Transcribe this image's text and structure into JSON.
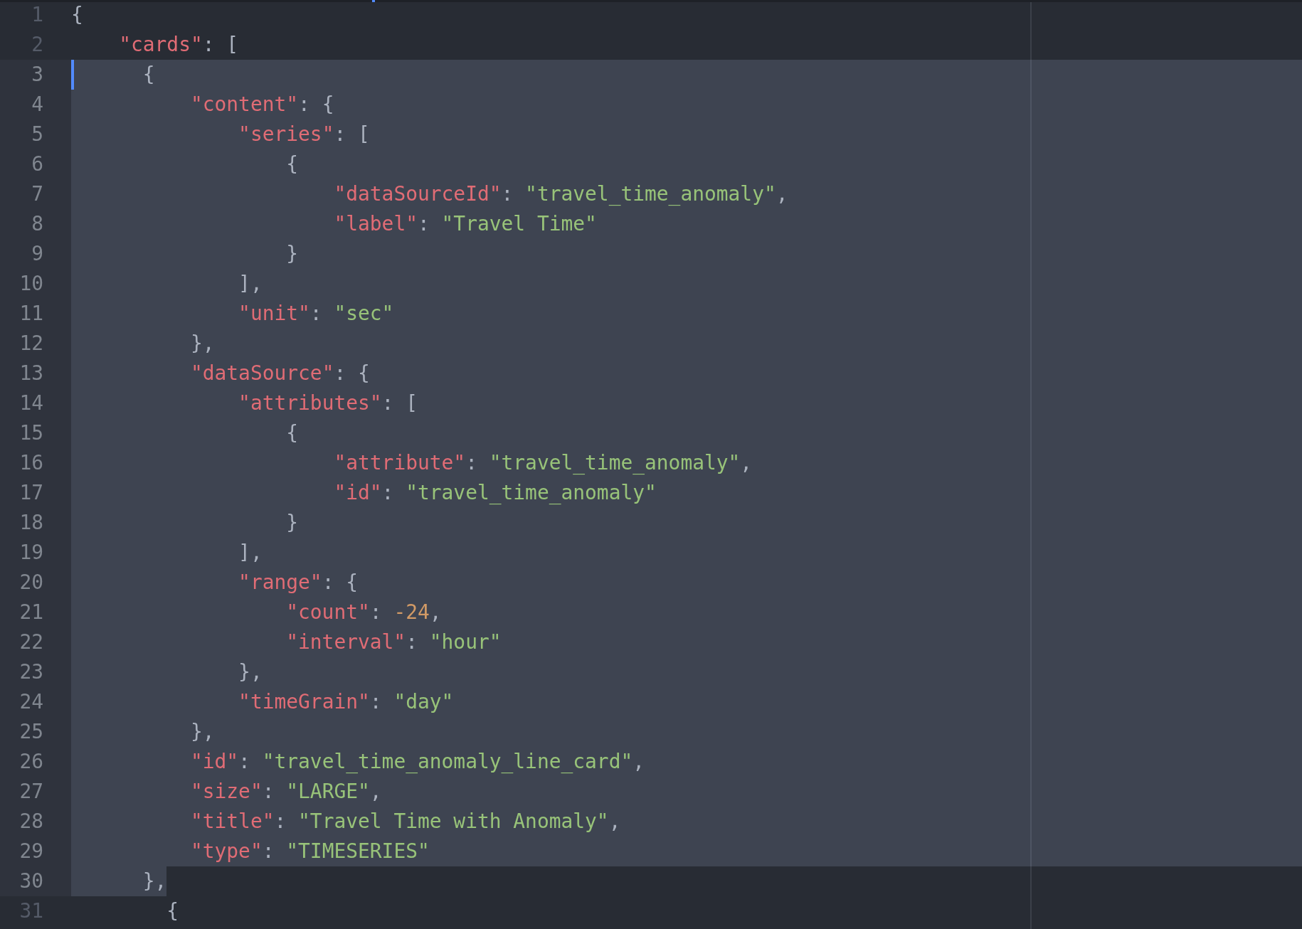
{
  "editor": {
    "lines": [
      {
        "number": "1",
        "selected": false,
        "cursor": false,
        "tokens": [
          {
            "kind": "punct",
            "text": "{"
          }
        ]
      },
      {
        "number": "2",
        "selected": false,
        "cursor": false,
        "tokens": [
          {
            "kind": "key",
            "text": "    \"cards\""
          },
          {
            "kind": "punct",
            "text": ": ["
          }
        ]
      },
      {
        "number": "3",
        "selected": true,
        "whole_line": true,
        "cursor": true,
        "tokens": [
          {
            "kind": "punct",
            "text": "      {"
          }
        ]
      },
      {
        "number": "4",
        "selected": true,
        "whole_line": true,
        "cursor": false,
        "tokens": [
          {
            "kind": "key",
            "text": "          \"content\""
          },
          {
            "kind": "punct",
            "text": ": {"
          }
        ]
      },
      {
        "number": "5",
        "selected": true,
        "whole_line": true,
        "cursor": false,
        "tokens": [
          {
            "kind": "key",
            "text": "              \"series\""
          },
          {
            "kind": "punct",
            "text": ": ["
          }
        ]
      },
      {
        "number": "6",
        "selected": true,
        "whole_line": true,
        "cursor": false,
        "tokens": [
          {
            "kind": "punct",
            "text": "                  {"
          }
        ]
      },
      {
        "number": "7",
        "selected": true,
        "whole_line": true,
        "cursor": false,
        "tokens": [
          {
            "kind": "key",
            "text": "                      \"dataSourceId\""
          },
          {
            "kind": "punct",
            "text": ": "
          },
          {
            "kind": "string",
            "text": "\"travel_time_anomaly\""
          },
          {
            "kind": "punct",
            "text": ","
          }
        ]
      },
      {
        "number": "8",
        "selected": true,
        "whole_line": true,
        "cursor": false,
        "tokens": [
          {
            "kind": "key",
            "text": "                      \"label\""
          },
          {
            "kind": "punct",
            "text": ": "
          },
          {
            "kind": "string",
            "text": "\"Travel Time\""
          }
        ]
      },
      {
        "number": "9",
        "selected": true,
        "whole_line": true,
        "cursor": false,
        "tokens": [
          {
            "kind": "punct",
            "text": "                  }"
          }
        ]
      },
      {
        "number": "10",
        "selected": true,
        "whole_line": true,
        "cursor": false,
        "tokens": [
          {
            "kind": "punct",
            "text": "              ],"
          }
        ]
      },
      {
        "number": "11",
        "selected": true,
        "whole_line": true,
        "cursor": false,
        "tokens": [
          {
            "kind": "key",
            "text": "              \"unit\""
          },
          {
            "kind": "punct",
            "text": ": "
          },
          {
            "kind": "string",
            "text": "\"sec\""
          }
        ]
      },
      {
        "number": "12",
        "selected": true,
        "whole_line": true,
        "cursor": false,
        "tokens": [
          {
            "kind": "punct",
            "text": "          },"
          }
        ]
      },
      {
        "number": "13",
        "selected": true,
        "whole_line": true,
        "cursor": false,
        "tokens": [
          {
            "kind": "key",
            "text": "          \"dataSource\""
          },
          {
            "kind": "punct",
            "text": ": {"
          }
        ]
      },
      {
        "number": "14",
        "selected": true,
        "whole_line": true,
        "cursor": false,
        "tokens": [
          {
            "kind": "key",
            "text": "              \"attributes\""
          },
          {
            "kind": "punct",
            "text": ": ["
          }
        ]
      },
      {
        "number": "15",
        "selected": true,
        "whole_line": true,
        "cursor": false,
        "tokens": [
          {
            "kind": "punct",
            "text": "                  {"
          }
        ]
      },
      {
        "number": "16",
        "selected": true,
        "whole_line": true,
        "cursor": false,
        "tokens": [
          {
            "kind": "key",
            "text": "                      \"attribute\""
          },
          {
            "kind": "punct",
            "text": ": "
          },
          {
            "kind": "string",
            "text": "\"travel_time_anomaly\""
          },
          {
            "kind": "punct",
            "text": ","
          }
        ]
      },
      {
        "number": "17",
        "selected": true,
        "whole_line": true,
        "cursor": false,
        "tokens": [
          {
            "kind": "key",
            "text": "                      \"id\""
          },
          {
            "kind": "punct",
            "text": ": "
          },
          {
            "kind": "string",
            "text": "\"travel_time_anomaly\""
          }
        ]
      },
      {
        "number": "18",
        "selected": true,
        "whole_line": true,
        "cursor": false,
        "tokens": [
          {
            "kind": "punct",
            "text": "                  }"
          }
        ]
      },
      {
        "number": "19",
        "selected": true,
        "whole_line": true,
        "cursor": false,
        "tokens": [
          {
            "kind": "punct",
            "text": "              ],"
          }
        ]
      },
      {
        "number": "20",
        "selected": true,
        "whole_line": true,
        "cursor": false,
        "tokens": [
          {
            "kind": "key",
            "text": "              \"range\""
          },
          {
            "kind": "punct",
            "text": ": {"
          }
        ]
      },
      {
        "number": "21",
        "selected": true,
        "whole_line": true,
        "cursor": false,
        "tokens": [
          {
            "kind": "key",
            "text": "                  \"count\""
          },
          {
            "kind": "punct",
            "text": ": "
          },
          {
            "kind": "number",
            "text": "-24"
          },
          {
            "kind": "punct",
            "text": ","
          }
        ]
      },
      {
        "number": "22",
        "selected": true,
        "whole_line": true,
        "cursor": false,
        "tokens": [
          {
            "kind": "key",
            "text": "                  \"interval\""
          },
          {
            "kind": "punct",
            "text": ": "
          },
          {
            "kind": "string",
            "text": "\"hour\""
          }
        ]
      },
      {
        "number": "23",
        "selected": true,
        "whole_line": true,
        "cursor": false,
        "tokens": [
          {
            "kind": "punct",
            "text": "              },"
          }
        ]
      },
      {
        "number": "24",
        "selected": true,
        "whole_line": true,
        "cursor": false,
        "tokens": [
          {
            "kind": "key",
            "text": "              \"timeGrain\""
          },
          {
            "kind": "punct",
            "text": ": "
          },
          {
            "kind": "string",
            "text": "\"day\""
          }
        ]
      },
      {
        "number": "25",
        "selected": true,
        "whole_line": true,
        "cursor": false,
        "tokens": [
          {
            "kind": "punct",
            "text": "          },"
          }
        ]
      },
      {
        "number": "26",
        "selected": true,
        "whole_line": true,
        "cursor": false,
        "tokens": [
          {
            "kind": "key",
            "text": "          \"id\""
          },
          {
            "kind": "punct",
            "text": ": "
          },
          {
            "kind": "string",
            "text": "\"travel_time_anomaly_line_card\""
          },
          {
            "kind": "punct",
            "text": ","
          }
        ]
      },
      {
        "number": "27",
        "selected": true,
        "whole_line": true,
        "cursor": false,
        "tokens": [
          {
            "kind": "key",
            "text": "          \"size\""
          },
          {
            "kind": "punct",
            "text": ": "
          },
          {
            "kind": "string",
            "text": "\"LARGE\""
          },
          {
            "kind": "punct",
            "text": ","
          }
        ]
      },
      {
        "number": "28",
        "selected": true,
        "whole_line": true,
        "cursor": false,
        "tokens": [
          {
            "kind": "key",
            "text": "          \"title\""
          },
          {
            "kind": "punct",
            "text": ": "
          },
          {
            "kind": "string",
            "text": "\"Travel Time with Anomaly\""
          },
          {
            "kind": "punct",
            "text": ","
          }
        ]
      },
      {
        "number": "29",
        "selected": true,
        "whole_line": true,
        "cursor": false,
        "tokens": [
          {
            "kind": "key",
            "text": "          \"type\""
          },
          {
            "kind": "punct",
            "text": ": "
          },
          {
            "kind": "string",
            "text": "\"TIMESERIES\""
          }
        ]
      },
      {
        "number": "30",
        "selected": true,
        "whole_line": false,
        "cursor": false,
        "tokens": [
          {
            "kind": "punct",
            "text": "      },"
          }
        ]
      },
      {
        "number": "31",
        "selected": false,
        "cursor": false,
        "tokens": [
          {
            "kind": "punct",
            "text": "        {"
          }
        ]
      }
    ]
  }
}
